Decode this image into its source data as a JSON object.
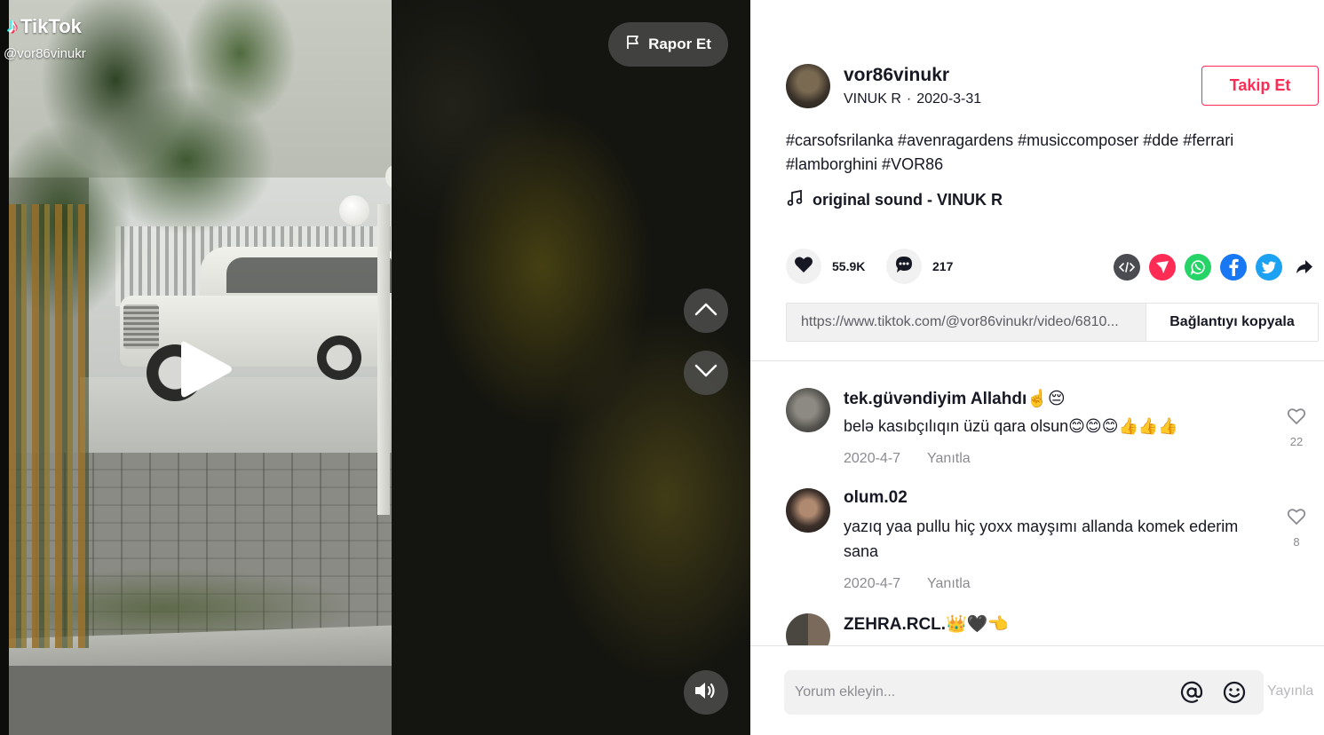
{
  "video": {
    "logo_text": "TikTok",
    "watermark_user": "@vor86vinukr",
    "report_label": "Rapor Et"
  },
  "author": {
    "username": "vor86vinukr",
    "display_name": "VINUK R",
    "separator": "·",
    "date": "2020-3-31",
    "follow_label": "Takip Et"
  },
  "caption": "#carsofsrilanka #avenragardens #musiccomposer #dde #ferrari #lamborghini #VOR86",
  "music": "original sound - VINUK R",
  "stats": {
    "likes": "55.9K",
    "comments": "217"
  },
  "share": {
    "icons": [
      "embed-icon",
      "send-icon",
      "whatsapp-icon",
      "facebook-icon",
      "twitter-icon",
      "share-arrow-icon"
    ]
  },
  "link": {
    "url": "https://www.tiktok.com/@vor86vinukr/video/6810...",
    "copy_label": "Bağlantıyı kopyala"
  },
  "comments": [
    {
      "user": "tek.güvəndiyim Allahdı☝️😔",
      "text": "belə kasıbçılıqın üzü qara olsun😊😊😊👍👍👍",
      "date": "2020-4-7",
      "reply": "Yanıtla",
      "likes": "22"
    },
    {
      "user": "olum.02",
      "text": "yazıq yaa pullu hiç yoxx mayşımı allanda komek ederim sana",
      "date": "2020-4-7",
      "reply": "Yanıtla",
      "likes": "8"
    },
    {
      "user": "ZEHRA.RCL.👑🖤👈",
      "text": "",
      "date": "",
      "reply": "",
      "likes": ""
    }
  ],
  "comment_bar": {
    "placeholder": "Yorum ekleyin...",
    "post_label": "Yayınla"
  },
  "colors": {
    "accent": "#fe2c55",
    "text": "#161823",
    "muted": "#8a8b91"
  }
}
